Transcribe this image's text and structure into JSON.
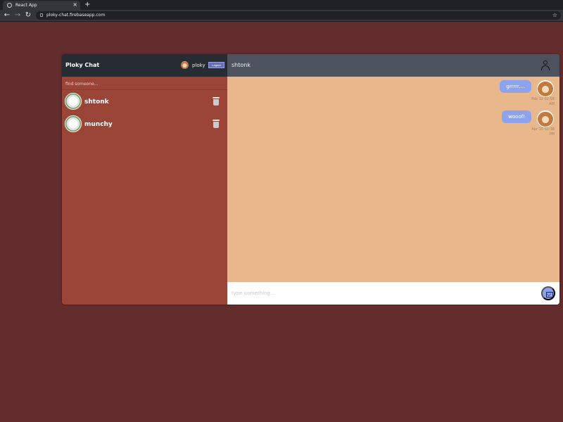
{
  "browser": {
    "tab_title": "React App",
    "tab_close": "×",
    "new_tab": "+",
    "back": "←",
    "forward": "→",
    "reload": "↻",
    "url": "ploky-chat.firebaseapp.com",
    "bookmark": "☆"
  },
  "app": {
    "brand": "Ploky Chat",
    "current_user": "ploky",
    "logout_label": "Logout",
    "search_placeholder": "find someone...",
    "contacts": [
      {
        "name": "shtonk"
      },
      {
        "name": "munchy"
      }
    ],
    "chat": {
      "title": "shtonk",
      "messages": [
        {
          "text": "grrrrr....",
          "time": "Feb 12 02:56 AM"
        },
        {
          "text": "wooof!",
          "time": "Apr 10 01:38 PM"
        }
      ],
      "compose_placeholder": "type something..."
    }
  },
  "colors": {
    "page_bg": "#632d2e",
    "sidebar_bg": "#9b4438",
    "header_dark": "#272c33",
    "chat_header": "#4d535e",
    "chat_bg": "#e8b78b",
    "bubble": "#8ea3ee",
    "logout_btn": "#6a6fb5"
  },
  "icons": {
    "tab_favicon": "globe-icon",
    "lock": "lock-icon",
    "star": "star-icon",
    "trash": "trash-icon",
    "profile": "user-profile-icon",
    "send": "envelope-icon"
  }
}
